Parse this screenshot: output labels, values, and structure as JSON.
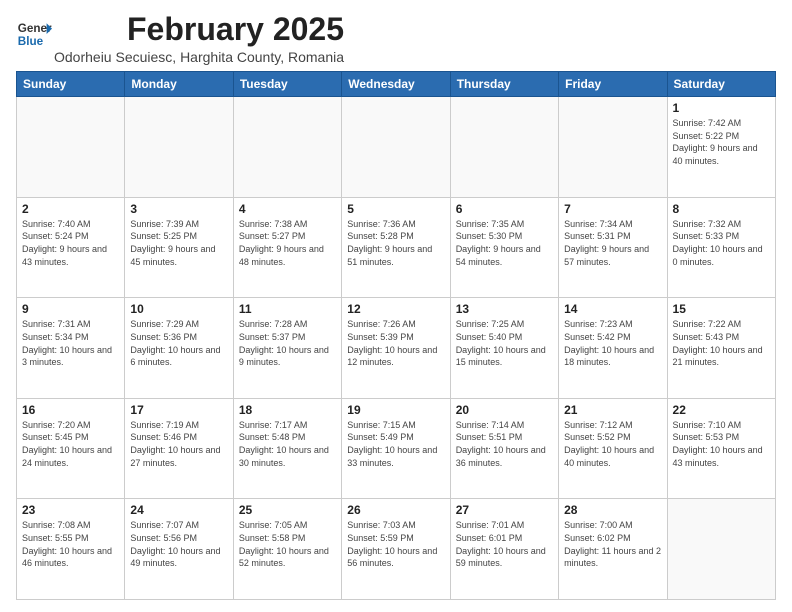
{
  "header": {
    "logo_general": "General",
    "logo_blue": "Blue",
    "title": "February 2025",
    "subtitle": "Odorheiu Secuiesc, Harghita County, Romania"
  },
  "days_of_week": [
    "Sunday",
    "Monday",
    "Tuesday",
    "Wednesday",
    "Thursday",
    "Friday",
    "Saturday"
  ],
  "weeks": [
    [
      {
        "day": "",
        "info": ""
      },
      {
        "day": "",
        "info": ""
      },
      {
        "day": "",
        "info": ""
      },
      {
        "day": "",
        "info": ""
      },
      {
        "day": "",
        "info": ""
      },
      {
        "day": "",
        "info": ""
      },
      {
        "day": "1",
        "info": "Sunrise: 7:42 AM\nSunset: 5:22 PM\nDaylight: 9 hours and 40 minutes."
      }
    ],
    [
      {
        "day": "2",
        "info": "Sunrise: 7:40 AM\nSunset: 5:24 PM\nDaylight: 9 hours and 43 minutes."
      },
      {
        "day": "3",
        "info": "Sunrise: 7:39 AM\nSunset: 5:25 PM\nDaylight: 9 hours and 45 minutes."
      },
      {
        "day": "4",
        "info": "Sunrise: 7:38 AM\nSunset: 5:27 PM\nDaylight: 9 hours and 48 minutes."
      },
      {
        "day": "5",
        "info": "Sunrise: 7:36 AM\nSunset: 5:28 PM\nDaylight: 9 hours and 51 minutes."
      },
      {
        "day": "6",
        "info": "Sunrise: 7:35 AM\nSunset: 5:30 PM\nDaylight: 9 hours and 54 minutes."
      },
      {
        "day": "7",
        "info": "Sunrise: 7:34 AM\nSunset: 5:31 PM\nDaylight: 9 hours and 57 minutes."
      },
      {
        "day": "8",
        "info": "Sunrise: 7:32 AM\nSunset: 5:33 PM\nDaylight: 10 hours and 0 minutes."
      }
    ],
    [
      {
        "day": "9",
        "info": "Sunrise: 7:31 AM\nSunset: 5:34 PM\nDaylight: 10 hours and 3 minutes."
      },
      {
        "day": "10",
        "info": "Sunrise: 7:29 AM\nSunset: 5:36 PM\nDaylight: 10 hours and 6 minutes."
      },
      {
        "day": "11",
        "info": "Sunrise: 7:28 AM\nSunset: 5:37 PM\nDaylight: 10 hours and 9 minutes."
      },
      {
        "day": "12",
        "info": "Sunrise: 7:26 AM\nSunset: 5:39 PM\nDaylight: 10 hours and 12 minutes."
      },
      {
        "day": "13",
        "info": "Sunrise: 7:25 AM\nSunset: 5:40 PM\nDaylight: 10 hours and 15 minutes."
      },
      {
        "day": "14",
        "info": "Sunrise: 7:23 AM\nSunset: 5:42 PM\nDaylight: 10 hours and 18 minutes."
      },
      {
        "day": "15",
        "info": "Sunrise: 7:22 AM\nSunset: 5:43 PM\nDaylight: 10 hours and 21 minutes."
      }
    ],
    [
      {
        "day": "16",
        "info": "Sunrise: 7:20 AM\nSunset: 5:45 PM\nDaylight: 10 hours and 24 minutes."
      },
      {
        "day": "17",
        "info": "Sunrise: 7:19 AM\nSunset: 5:46 PM\nDaylight: 10 hours and 27 minutes."
      },
      {
        "day": "18",
        "info": "Sunrise: 7:17 AM\nSunset: 5:48 PM\nDaylight: 10 hours and 30 minutes."
      },
      {
        "day": "19",
        "info": "Sunrise: 7:15 AM\nSunset: 5:49 PM\nDaylight: 10 hours and 33 minutes."
      },
      {
        "day": "20",
        "info": "Sunrise: 7:14 AM\nSunset: 5:51 PM\nDaylight: 10 hours and 36 minutes."
      },
      {
        "day": "21",
        "info": "Sunrise: 7:12 AM\nSunset: 5:52 PM\nDaylight: 10 hours and 40 minutes."
      },
      {
        "day": "22",
        "info": "Sunrise: 7:10 AM\nSunset: 5:53 PM\nDaylight: 10 hours and 43 minutes."
      }
    ],
    [
      {
        "day": "23",
        "info": "Sunrise: 7:08 AM\nSunset: 5:55 PM\nDaylight: 10 hours and 46 minutes."
      },
      {
        "day": "24",
        "info": "Sunrise: 7:07 AM\nSunset: 5:56 PM\nDaylight: 10 hours and 49 minutes."
      },
      {
        "day": "25",
        "info": "Sunrise: 7:05 AM\nSunset: 5:58 PM\nDaylight: 10 hours and 52 minutes."
      },
      {
        "day": "26",
        "info": "Sunrise: 7:03 AM\nSunset: 5:59 PM\nDaylight: 10 hours and 56 minutes."
      },
      {
        "day": "27",
        "info": "Sunrise: 7:01 AM\nSunset: 6:01 PM\nDaylight: 10 hours and 59 minutes."
      },
      {
        "day": "28",
        "info": "Sunrise: 7:00 AM\nSunset: 6:02 PM\nDaylight: 11 hours and 2 minutes."
      },
      {
        "day": "",
        "info": ""
      }
    ]
  ]
}
